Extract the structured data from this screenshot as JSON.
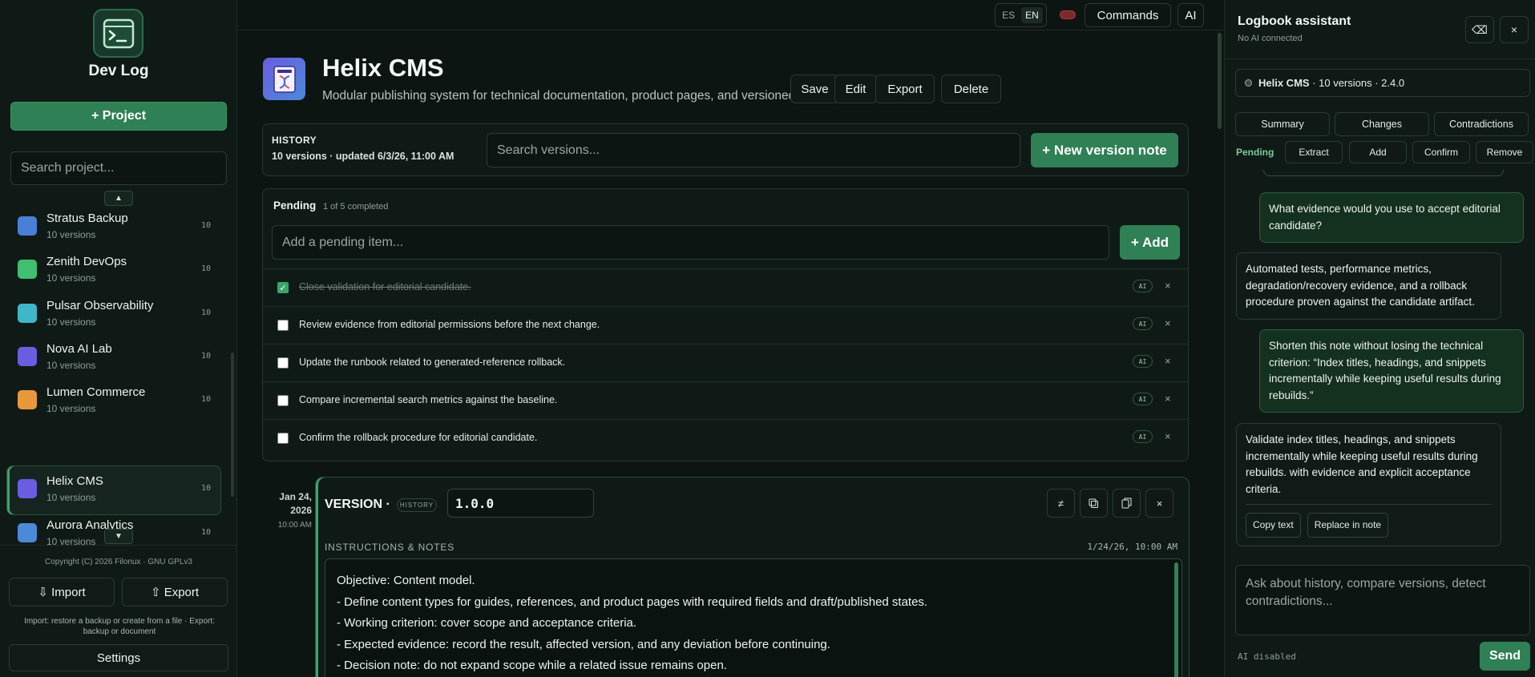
{
  "app": {
    "title": "Dev Log",
    "new_project_label": "+ Project",
    "search_placeholder": "Search project...",
    "scroll_up": "▲",
    "scroll_down": "▼"
  },
  "projects": [
    {
      "name": "Stratus Backup",
      "sub": "10 versions",
      "count": "10",
      "color": "#4a7fd8"
    },
    {
      "name": "Zenith DevOps",
      "sub": "10 versions",
      "count": "10",
      "color": "#3fbf6f"
    },
    {
      "name": "Pulsar Observability",
      "sub": "10 versions",
      "count": "10",
      "color": "#3fb6c9"
    },
    {
      "name": "Nova AI Lab",
      "sub": "10 versions",
      "count": "10",
      "color": "#6a5de0"
    },
    {
      "name": "Lumen Commerce",
      "sub": "10 versions",
      "count": "10",
      "color": "#e8983a"
    },
    {
      "name": "Helix CMS",
      "sub": "10 versions",
      "count": "10",
      "color": "#6a5de0",
      "active": true
    },
    {
      "name": "Aurora Analytics",
      "sub": "10 versions",
      "count": "10",
      "color": "#4a8ad8"
    }
  ],
  "sidebar_footer": {
    "copyright": "Copyright (C) 2026 Filonux · GNU GPLv3",
    "import_label": "⇩ Import",
    "export_label": "⇧ Export",
    "help": "Import: restore a backup or create from a file · Export: backup or document",
    "settings_label": "Settings"
  },
  "topbar": {
    "lang_es": "ES",
    "lang_en": "EN",
    "commands_label": "Commands",
    "ai_label": "AI"
  },
  "project": {
    "title": "Helix CMS",
    "description": "Modular publishing system for technical documentation, product pages, and versioned content.",
    "save_label": "Save",
    "edit_label": "Edit",
    "export_label": "Export",
    "delete_label": "Delete"
  },
  "history": {
    "label": "HISTORY",
    "meta": "10 versions · updated 6/3/26, 11:00 AM",
    "search_placeholder": "Search versions...",
    "new_version_label": "+ New version note"
  },
  "pending": {
    "title": "Pending",
    "count": "1 of 5 completed",
    "input_placeholder": "Add a pending item...",
    "add_label": "+ Add",
    "items": [
      {
        "text": "Close validation for editorial candidate.",
        "done": true,
        "badge": "AI"
      },
      {
        "text": "Review evidence from editorial permissions before the next change.",
        "done": false,
        "badge": "AI"
      },
      {
        "text": "Update the runbook related to generated-reference rollback.",
        "done": false,
        "badge": "AI"
      },
      {
        "text": "Compare incremental search metrics against the baseline.",
        "done": false,
        "badge": "AI"
      },
      {
        "text": "Confirm the rollback procedure for editorial candidate.",
        "done": false,
        "badge": "AI"
      }
    ]
  },
  "version": {
    "date_line1": "Jan 24,",
    "date_line2": "2026",
    "time": "10:00 AM",
    "label": "VERSION ·",
    "chip": "HISTORY",
    "value": "1.0.0",
    "notes_label": "INSTRUCTIONS & NOTES",
    "notes_date": "1/24/26, 10:00 AM",
    "notes": [
      "Objective: Content model.",
      "- Define content types for guides, references, and product pages with required fields and draft/published states.",
      "- Working criterion: cover scope and acceptance criteria.",
      "- Expected evidence: record the result, affected version, and any deviation before continuing.",
      "- Decision note: do not expand scope while a related issue remains open."
    ]
  },
  "assistant": {
    "title": "Logbook assistant",
    "subtitle": "No AI connected",
    "context_name": "Helix CMS",
    "context_meta": " · 10 versions · 2.4.0",
    "tabs": [
      "Summary",
      "Changes",
      "Contradictions"
    ],
    "pending_label": "Pending",
    "actions": [
      "Extract",
      "Add",
      "Confirm",
      "Remove"
    ],
    "messages": [
      {
        "role": "user",
        "text": "What evidence would you use to accept editorial candidate?"
      },
      {
        "role": "bot",
        "text": "Automated tests, performance metrics, degradation/recovery evidence, and a rollback procedure proven against the candidate artifact."
      },
      {
        "role": "user",
        "text": "Shorten this note without losing the technical criterion: “Index titles, headings, and snippets incrementally while keeping useful results during rebuilds.”"
      },
      {
        "role": "bot",
        "text": "Validate index titles, headings, and snippets incrementally while keeping useful results during rebuilds. with evidence and explicit acceptance criteria.",
        "copy_label": "Copy text",
        "replace_label": "Replace in note"
      }
    ],
    "input_placeholder": "Ask about history, compare versions, detect contradictions...",
    "status": "AI disabled",
    "send_label": "Send"
  }
}
